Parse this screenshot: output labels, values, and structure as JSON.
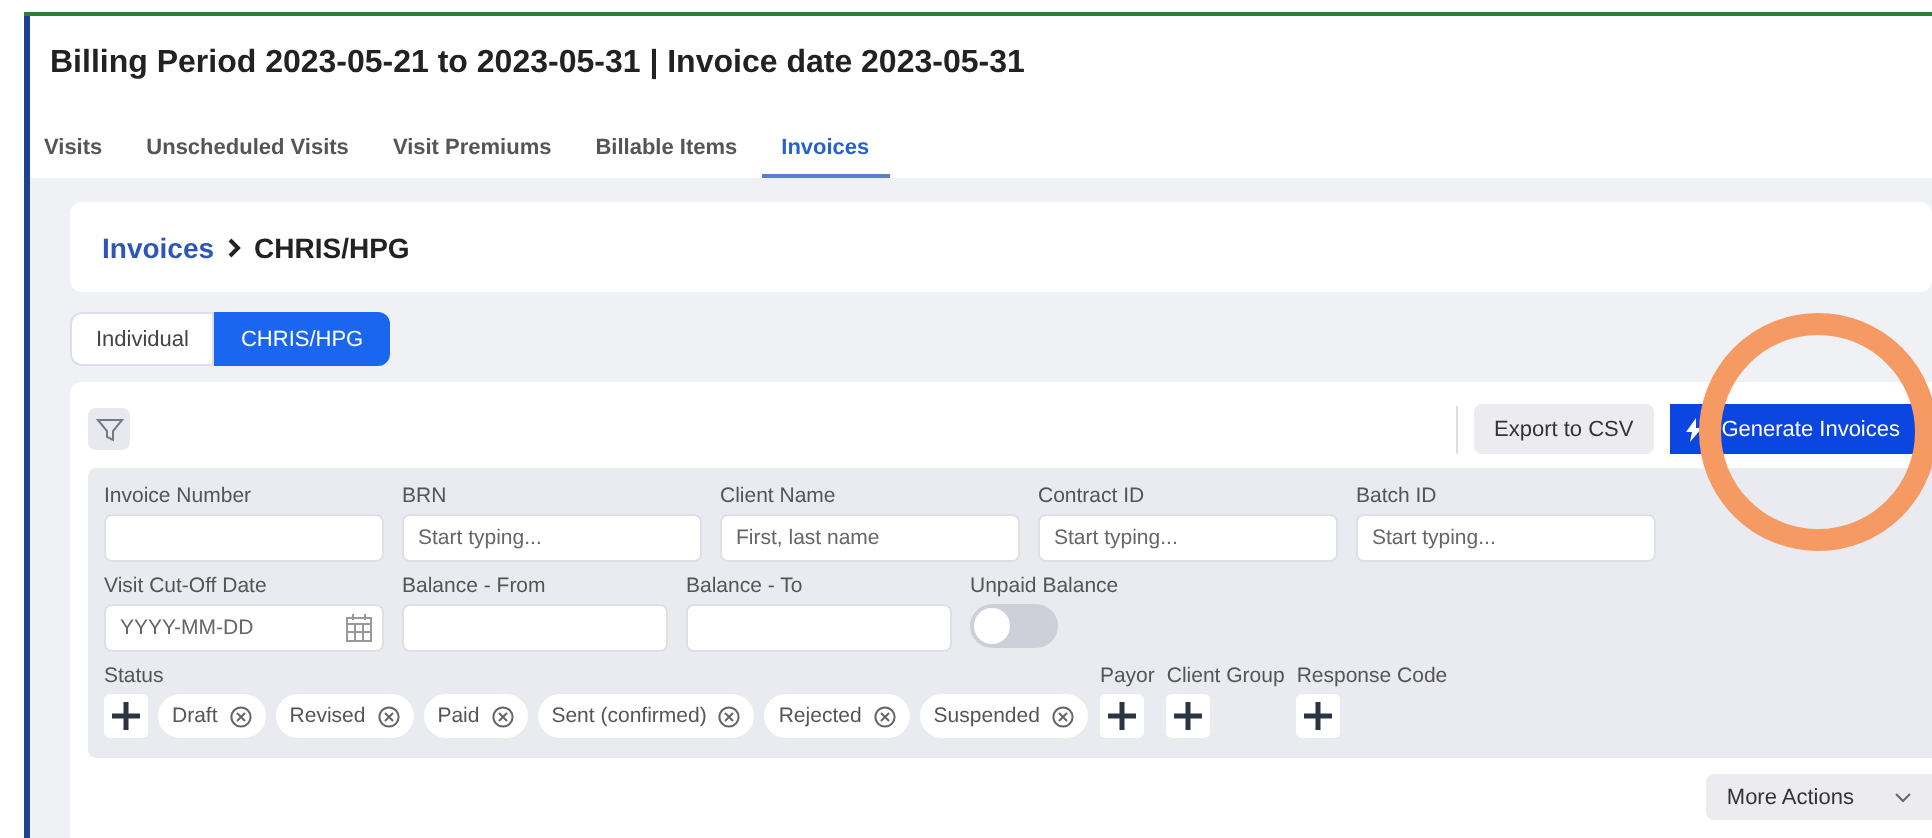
{
  "title": "Billing Period 2023-05-21 to 2023-05-31 | Invoice date 2023-05-31",
  "tabs": [
    {
      "label": "Visits",
      "selected": false
    },
    {
      "label": "Unscheduled Visits",
      "selected": false
    },
    {
      "label": "Visit Premiums",
      "selected": false
    },
    {
      "label": "Billable Items",
      "selected": false
    },
    {
      "label": "Invoices",
      "selected": true
    }
  ],
  "breadcrumb": {
    "parent": "Invoices",
    "current": "CHRIS/HPG"
  },
  "segments": [
    {
      "label": "Individual",
      "selected": false
    },
    {
      "label": "CHRIS/HPG",
      "selected": true
    }
  ],
  "toolbar": {
    "export": "Export to CSV",
    "generate": "Generate Invoices"
  },
  "filter_rows": [
    [
      {
        "kind": "text",
        "label": "Invoice Number"
      },
      {
        "kind": "text",
        "label": "BRN",
        "placeholder": "Start typing..."
      },
      {
        "kind": "text",
        "label": "Client Name",
        "placeholder": "First, last name"
      },
      {
        "kind": "text",
        "label": "Contract ID",
        "placeholder": "Start typing..."
      },
      {
        "kind": "text",
        "label": "Batch ID",
        "placeholder": "Start typing..."
      }
    ],
    [
      {
        "kind": "date",
        "label": "Visit Cut-Off Date",
        "placeholder": "YYYY-MM-DD"
      },
      {
        "kind": "text",
        "label": "Balance - From"
      },
      {
        "kind": "text",
        "label": "Balance - To"
      },
      {
        "kind": "toggle",
        "label": "Unpaid Balance",
        "on": false
      }
    ]
  ],
  "status": {
    "label": "Status",
    "chips": [
      "Draft",
      "Revised",
      "Paid",
      "Sent (confirmed)",
      "Rejected",
      "Suspended"
    ]
  },
  "add_groups": [
    "Payor",
    "Client Group",
    "Response Code"
  ],
  "more_actions": "More Actions"
}
